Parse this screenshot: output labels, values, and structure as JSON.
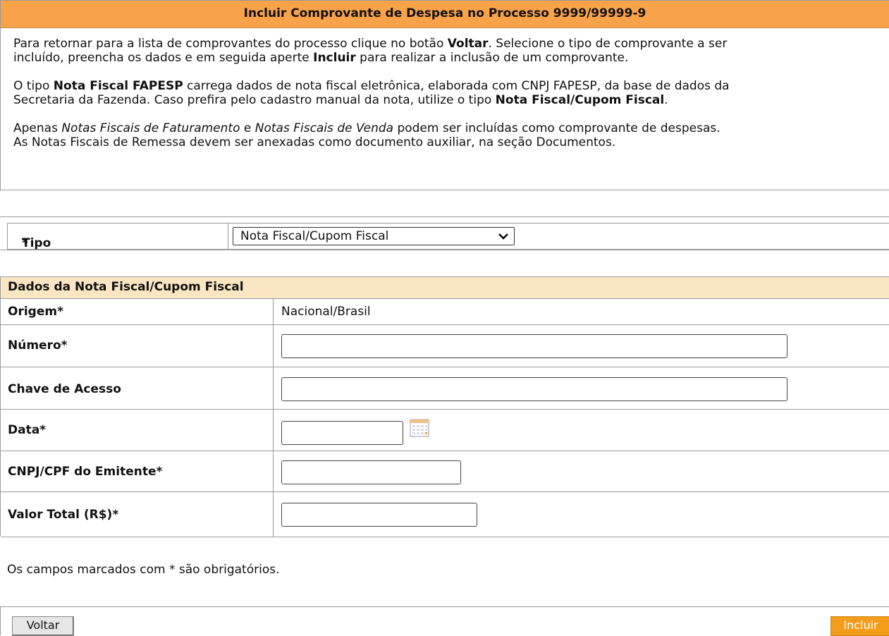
{
  "header": {
    "title": "Incluir Comprovante de Despesa no Processo 9999/99999-9",
    "p1": [
      {
        "t": "Para retornar para a lista de comprovantes do processo clique no botão ",
        "b": false
      },
      {
        "t": "Voltar",
        "b": true
      },
      {
        "t": ". Selecione o tipo de comprovante a ser",
        "b": false
      }
    ],
    "p1b": [
      {
        "t": "incluído, preencha os dados e em seguida aperte ",
        "b": false
      },
      {
        "t": "Incluir",
        "b": true
      },
      {
        "t": " para realizar a inclusão de um comprovante.",
        "b": false
      }
    ],
    "p2": [
      {
        "t": "O tipo ",
        "b": false
      },
      {
        "t": "Nota Fiscal FAPESP",
        "b": true
      },
      {
        "t": " carrega dados de nota fiscal eletrônica, elaborada com CNPJ FAPESP, da base de dados da",
        "b": false
      }
    ],
    "p2b": [
      {
        "t": "Secretaria da Fazenda. Caso prefira pelo cadastro manual da nota, utilize o tipo ",
        "b": false
      },
      {
        "t": "Nota Fiscal/Cupom Fiscal",
        "b": true
      },
      {
        "t": ".",
        "b": false
      }
    ],
    "p3": [
      {
        "t": "Apenas ",
        "i": false
      },
      {
        "t": "Notas Fiscais de Faturamento",
        "i": true
      },
      {
        "t": " e ",
        "i": false
      },
      {
        "t": "Notas Fiscais de Venda",
        "i": true
      },
      {
        "t": " podem ser incluídas como comprovante de despesas.",
        "i": false
      }
    ],
    "p3b": "As Notas Fiscais de Remessa devem ser anexadas como documento auxiliar, na seção Documentos."
  },
  "tipo": {
    "label": "Tipo",
    "required_mark": "*",
    "selected": "Nota Fiscal/Cupom Fiscal"
  },
  "form": {
    "section_title": "Dados da Nota Fiscal/Cupom Fiscal",
    "origem_label": "Origem*",
    "origem_value": "Nacional/Brasil",
    "numero_label": "Número*",
    "chave_label": "Chave de Acesso",
    "data_label": "Data*",
    "cnpj_label": "CNPJ/CPF do Emitente*",
    "valor_label": "Valor Total (R$)*"
  },
  "footer": {
    "required_note": "Os campos marcados com * são obrigatórios.",
    "voltar_label": "Voltar",
    "incluir_label": "Incluir"
  }
}
